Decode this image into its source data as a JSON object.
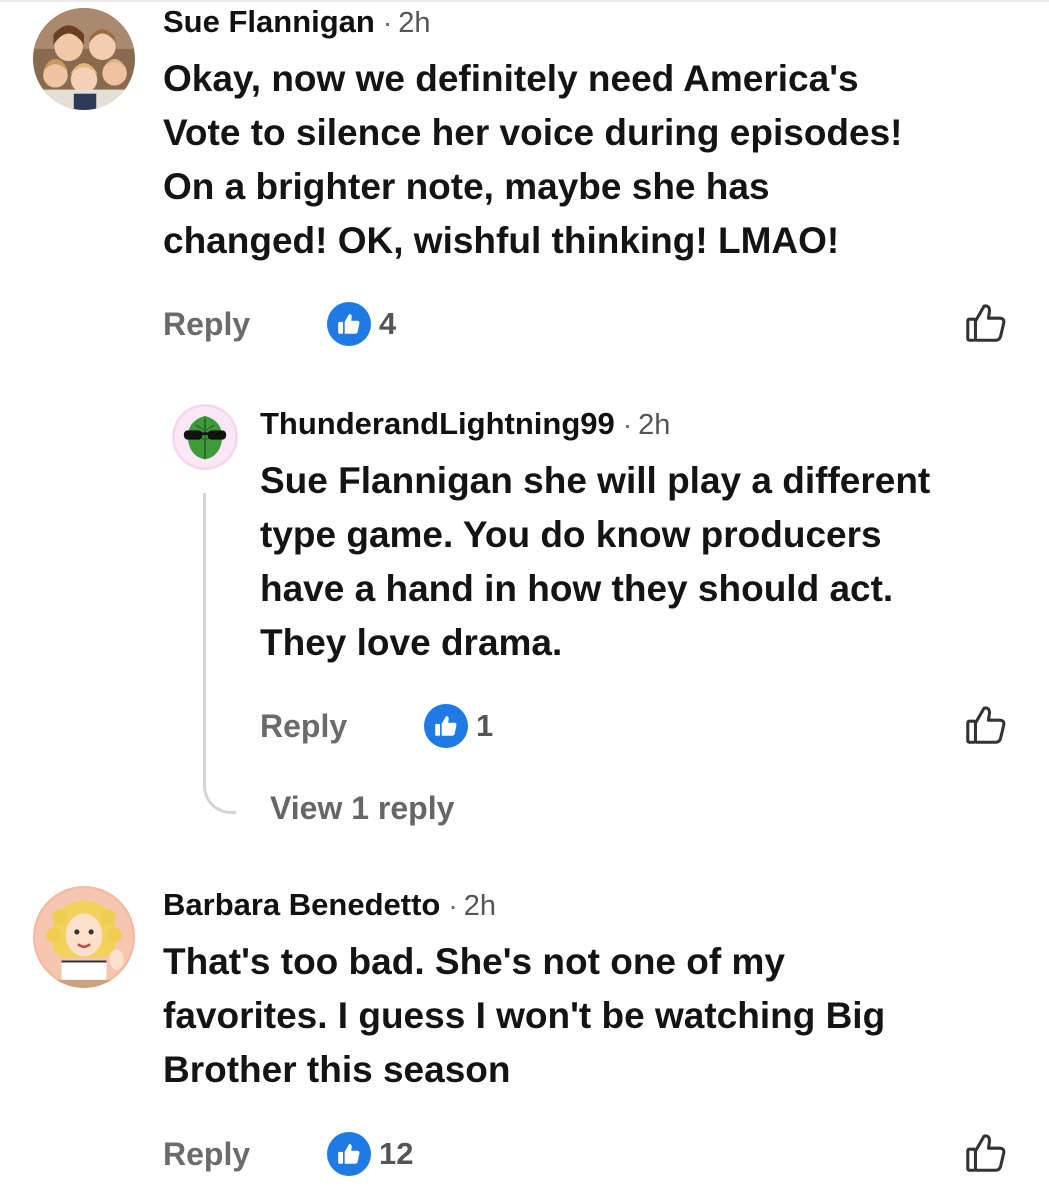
{
  "comments": [
    {
      "author": "Sue Flannigan",
      "time": "2h",
      "text": [
        "Okay, now we definitely need America's",
        "Vote to silence her voice during episodes!",
        "On a brighter note, maybe she has",
        "changed!  OK, wishful thinking!  LMAO!"
      ],
      "reply_label": "Reply",
      "likes": "4"
    },
    {
      "author": "ThunderandLightning99",
      "time": "2h",
      "text": [
        "Sue Flannigan  she will play a different",
        "type game.  You do know producers",
        "have a hand in how they should act.",
        "They love drama."
      ],
      "reply_label": "Reply",
      "likes": "1",
      "view_replies": "View 1 reply"
    },
    {
      "author": "Barbara Benedetto",
      "time": "2h",
      "text": [
        "That's too bad. She's not one of my",
        "favorites. I guess I won't be watching Big",
        "Brother this season"
      ],
      "reply_label": "Reply",
      "likes": "12"
    }
  ],
  "separator": "·",
  "icons": {
    "like_badge": "thumbs-up-filled-icon",
    "like_button": "thumbs-up-outline-icon"
  },
  "colors": {
    "like_blue": "#1f7ae6",
    "muted_text": "#6b6b6b",
    "thread_line": "#d4d4d8"
  }
}
